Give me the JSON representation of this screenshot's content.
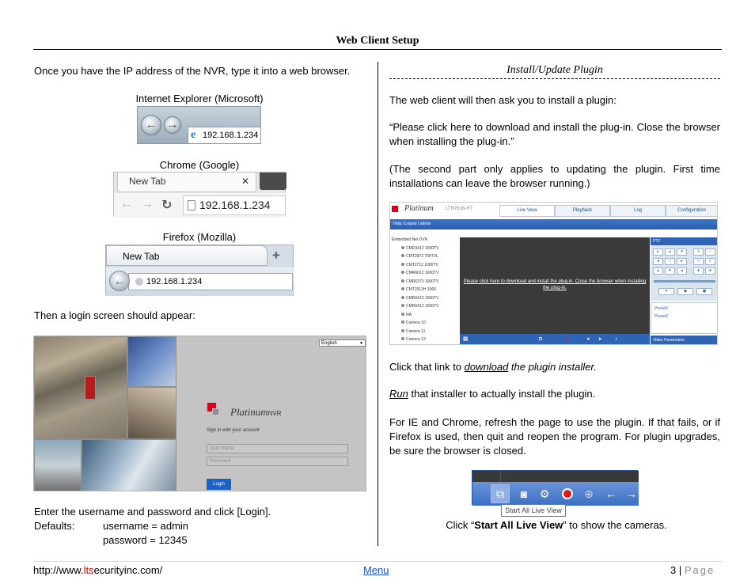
{
  "header": {
    "title": "Web Client Setup"
  },
  "left": {
    "intro": "Once you have the IP address of the NVR, type it into a web browser.",
    "ie_caption": "Internet Explorer (Microsoft)",
    "ie_address": "192.168.1.234",
    "chrome_caption": "Chrome (Google)",
    "chrome_tab": "New Tab",
    "chrome_address": "192.168.1.234",
    "firefox_caption": "Firefox (Mozilla)",
    "firefox_tab": "New Tab",
    "firefox_address": "192.168.1.234",
    "login_intro": "Then a login screen should appear:",
    "login_screen": {
      "language": "English",
      "brand": "Platinum",
      "brand_suffix": "NVR",
      "signin_text": "Sign in with your account",
      "username_placeholder": "User Name",
      "password_placeholder": "Password",
      "login_button": "Login"
    },
    "enter_text": "Enter the username and password and click [Login].",
    "defaults_label": "Defaults:",
    "default_username": "username = admin",
    "default_password": "password = 12345"
  },
  "right": {
    "section_title": "Install/Update Plugin",
    "p1": "The web client will then ask you to install a plugin:",
    "p2": "“Please click here to download and install the plug-in. Close the browser when installing the plug-in.”",
    "p3": "(The second part only applies to updating the plugin.  First time installations can leave the browser running.)",
    "plugin_screen": {
      "brand": "Platinum",
      "model": "LTN7616-HT",
      "tabs": [
        "Live View",
        "Playback",
        "Log",
        "Configuration"
      ],
      "nav": "Help  |  Logout  |  admin",
      "tree_root": "Embedded Net DVR",
      "cameras": [
        "CMD3413 1000TV",
        "CMT2873 700TVL",
        "CMT2712 1000TV",
        "CMR6612 1000TV",
        "CMR6373 1000TV",
        "CMT2512H 1000",
        "CMR6412 1000TV",
        "CMR6412 1000TV",
        "NA",
        "Camera 10",
        "Camera 11",
        "Camera 12"
      ],
      "message": "Please click here to download and install the plug-in. Close the browser when installing the plug-in.",
      "ptz_label": "PTZ",
      "presets": [
        "Preset1",
        "Preset2"
      ],
      "video_params": "Video Parameters"
    },
    "p4_link": "download",
    "p4_pre": "Click that link to ",
    "p4_post": " the plugin installer.",
    "p5_link": "Run",
    "p5_post": " that installer to actually install the plugin.",
    "p6": "For IE and Chrome, refresh the page to use the plugin.  If that fails, or if Firefox is used, then quit and reopen the program.  For plugin upgrades, be sure the browser is closed.",
    "tooltip": "Start All Live View",
    "caption_pre": "Click “",
    "caption_bold": "Start All Live View",
    "caption_post": "” to show the cameras."
  },
  "footer": {
    "url_pre": "http://www.",
    "url_red": "lts",
    "url_post": "ecurityinc.com/",
    "menu": "Menu",
    "page_num": "3",
    "page_sep": " | ",
    "page_word": "Page"
  }
}
